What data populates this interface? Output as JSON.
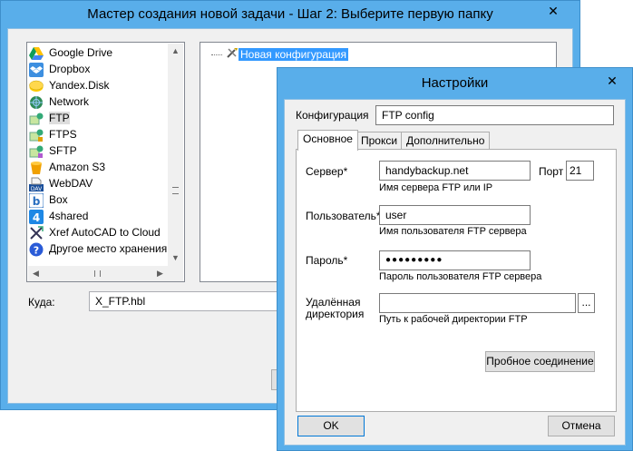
{
  "main_window": {
    "title": "Мастер создания новой задачи - Шаг 2: Выберите первую папку",
    "close_glyph": "✕",
    "storages": [
      {
        "label": "Google Drive",
        "icon": "google-drive-icon"
      },
      {
        "label": "Dropbox",
        "icon": "dropbox-icon"
      },
      {
        "label": "Yandex.Disk",
        "icon": "yandex-disk-icon"
      },
      {
        "label": "Network",
        "icon": "network-icon"
      },
      {
        "label": "FTP",
        "icon": "ftp-icon",
        "selected": true
      },
      {
        "label": "FTPS",
        "icon": "ftps-icon"
      },
      {
        "label": "SFTP",
        "icon": "sftp-icon"
      },
      {
        "label": "Amazon S3",
        "icon": "amazon-s3-icon"
      },
      {
        "label": "WebDAV",
        "icon": "webdav-icon"
      },
      {
        "label": "Box",
        "icon": "box-icon"
      },
      {
        "label": "4shared",
        "icon": "4shared-icon"
      },
      {
        "label": "Xref AutoCAD to Cloud",
        "icon": "xref-icon"
      },
      {
        "label": "Другое место хранения",
        "icon": "question-icon"
      }
    ],
    "tree_node": "Новая конфигурация",
    "destination_label": "Куда:",
    "destination_value": "X_FTP.hbl"
  },
  "settings_dialog": {
    "title": "Настройки",
    "close_glyph": "✕",
    "config_label": "Конфигурация",
    "config_value": "FTP config",
    "tabs": [
      {
        "label": "Основное",
        "active": true
      },
      {
        "label": "Прокси"
      },
      {
        "label": "Дополнительно"
      }
    ],
    "server_label": "Сервер*",
    "server_value": "handybackup.net",
    "server_hint": "Имя сервера FTP или IP",
    "port_label": "Порт",
    "port_value": "21",
    "user_label": "Пользователь*",
    "user_value": "user",
    "user_hint": "Имя пользователя FTP сервера",
    "password_label": "Пароль*",
    "password_value": "●●●●●●●●●",
    "password_hint": "Пароль пользователя FTP сервера",
    "remote_dir_label_1": "Удалённая",
    "remote_dir_label_2": "директория",
    "remote_dir_value": "",
    "remote_dir_hint": "Путь к рабочей директории FTP",
    "browse_label": "...",
    "test_button": "Пробное соединение",
    "ok_button": "OK",
    "cancel_button": "Отмена"
  },
  "colors": {
    "title_bar": "#59aeea",
    "selection": "#3399ff"
  }
}
